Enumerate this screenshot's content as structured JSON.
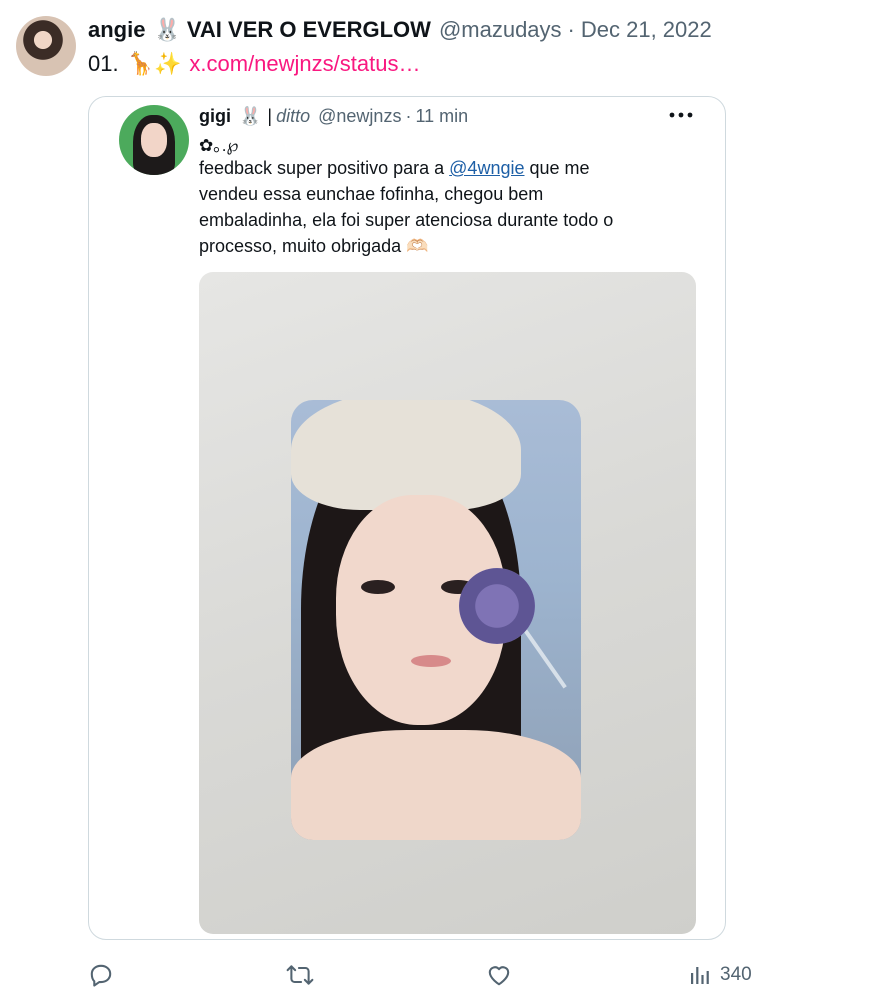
{
  "tweet": {
    "author": {
      "display_name": "angie",
      "name_emoji": "🐰",
      "name_suffix": "VAI VER O EVERGLOW",
      "handle": "@mazudays",
      "separator": "·",
      "date": "Dec 21, 2022"
    },
    "body": {
      "number": "01.",
      "emojis": "🦒✨",
      "link": "x.com/newjnzs/status…"
    },
    "quote": {
      "display_name": "gigi",
      "name_emoji": "🐰",
      "bar": "|",
      "ditto": "ditto",
      "handle": "@newjnzs",
      "separator": "·",
      "time": "11 min",
      "symbols": "✿｡.℘",
      "text_lines": [
        {
          "pre": "feedback super positivo para a ",
          "mention": "@4wngie",
          "post": " que me"
        },
        {
          "text": "vendeu essa eunchae fofinha, chegou bem"
        },
        {
          "text": "embaladinha, ela foi super atenciosa durante todo o"
        },
        {
          "text": "processo, muito obrigada 🫶🏻"
        }
      ]
    },
    "actions": {
      "views_count": "340"
    }
  },
  "icons": {
    "reply": "reply-icon",
    "retweet": "retweet-icon",
    "like": "heart-icon",
    "views": "analytics-icon",
    "more": "more-icon"
  },
  "colors": {
    "text_primary": "#0f1419",
    "text_secondary": "#536471",
    "link_pink": "#f91880",
    "mention_blue": "#1d5fa6",
    "border": "#cfd9de"
  }
}
